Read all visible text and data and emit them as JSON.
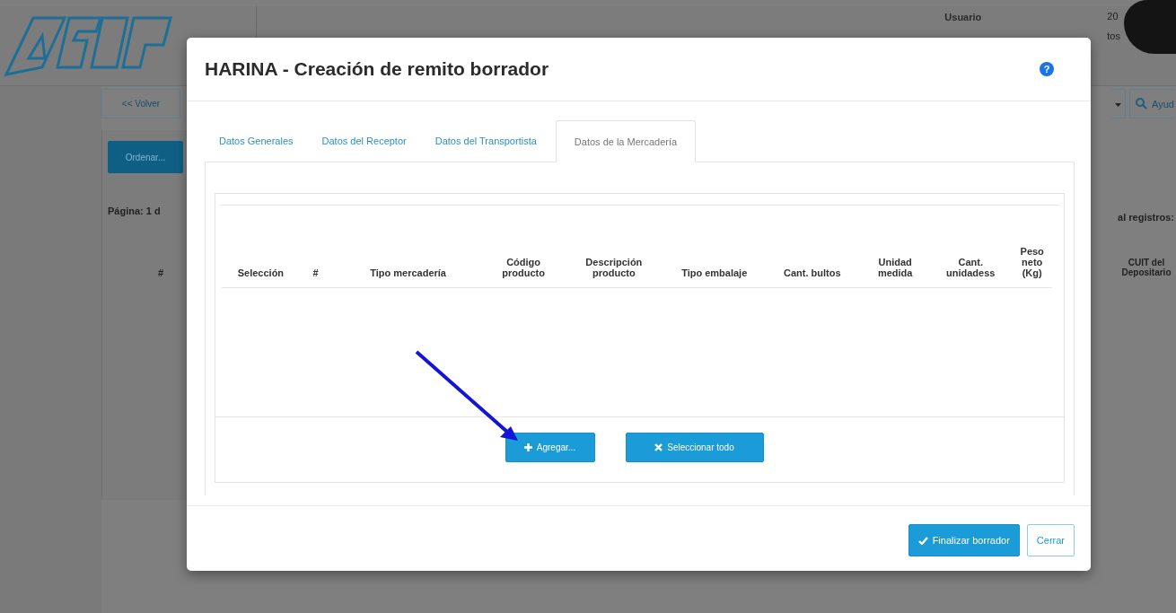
{
  "background": {
    "header": {
      "user_label": "Usuario",
      "user_value": "20",
      "user_extra": "tos"
    },
    "back_button": "<< Volver",
    "sort_button": "Ordenar...",
    "page_label": "Página: 1 d",
    "help_button": "Ayud",
    "total_label": "al registros:",
    "columns": [
      "#",
      "CUIT del Depositario"
    ]
  },
  "modal": {
    "title": "HARINA - Creación de remito borrador",
    "help_glyph": "?",
    "tabs": [
      {
        "label": "Datos Generales",
        "selected": false
      },
      {
        "label": "Datos del Receptor",
        "selected": false
      },
      {
        "label": "Datos del Transportista",
        "selected": false
      },
      {
        "label": "Datos de la Mercadería",
        "selected": true
      }
    ],
    "table": {
      "columns": [
        "Selección",
        "#",
        "Tipo mercadería",
        "Código producto",
        "Descripción producto",
        "Tipo embalaje",
        "Cant. bultos",
        "Unidad medida",
        "Cant. unidadess",
        "Peso neto (Kg)"
      ]
    },
    "table_buttons": [
      {
        "kind": "add",
        "label": "Agregar..."
      },
      {
        "kind": "select_all",
        "label": "Seleccionar todo"
      }
    ],
    "footer_buttons": [
      {
        "kind": "primary",
        "label": "Finalizar borrador"
      },
      {
        "kind": "plain",
        "label": "Cerrar"
      }
    ]
  }
}
